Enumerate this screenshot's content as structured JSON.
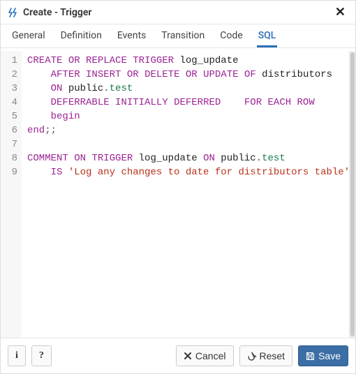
{
  "header": {
    "title": "Create - Trigger"
  },
  "tabs": [
    {
      "label": "General"
    },
    {
      "label": "Definition"
    },
    {
      "label": "Events"
    },
    {
      "label": "Transition"
    },
    {
      "label": "Code"
    },
    {
      "label": "SQL"
    }
  ],
  "active_tab_index": 5,
  "code_lines": [
    {
      "num": "1",
      "html": "<span class='kw'>CREATE</span> <span class='kw'>OR</span> <span class='kw'>REPLACE</span> <span class='kw'>TRIGGER</span> <span class='id'>log_update</span>"
    },
    {
      "num": "2",
      "html": "    <span class='kw'>AFTER</span> <span class='kw'>INSERT</span> <span class='kw'>OR</span> <span class='kw'>DELETE</span> <span class='kw'>OR</span> <span class='kw'>UPDATE</span> <span class='kw'>OF</span> <span class='id'>distributors</span>"
    },
    {
      "num": "3",
      "html": "    <span class='kw'>ON</span> <span class='id'>public</span><span class='pn'>.</span><span class='ns'>test</span>"
    },
    {
      "num": "4",
      "html": "    <span class='kw'>DEFERRABLE</span> <span class='kw'>INITIALLY</span> <span class='kw'>DEFERRED</span>    <span class='kw'>FOR</span> <span class='kw'>EACH</span> <span class='kw'>ROW</span>"
    },
    {
      "num": "5",
      "html": "    <span class='kw'>begin</span>"
    },
    {
      "num": "6",
      "html": "<span class='kw'>end</span><span class='pn'>;;</span>"
    },
    {
      "num": "7",
      "html": ""
    },
    {
      "num": "8",
      "html": "<span class='kw'>COMMENT</span> <span class='kw'>ON</span> <span class='kw'>TRIGGER</span> <span class='id'>log_update</span> <span class='kw'>ON</span> <span class='id'>public</span><span class='pn'>.</span><span class='ns'>test</span>"
    },
    {
      "num": "9",
      "html": "    <span class='kw'>IS</span> <span class='str'>'Log any changes to date for distributors table'</span><span class='pn'>;</span>"
    }
  ],
  "footer": {
    "info_label": "i",
    "help_label": "?",
    "cancel_label": "Cancel",
    "reset_label": "Reset",
    "save_label": "Save"
  }
}
